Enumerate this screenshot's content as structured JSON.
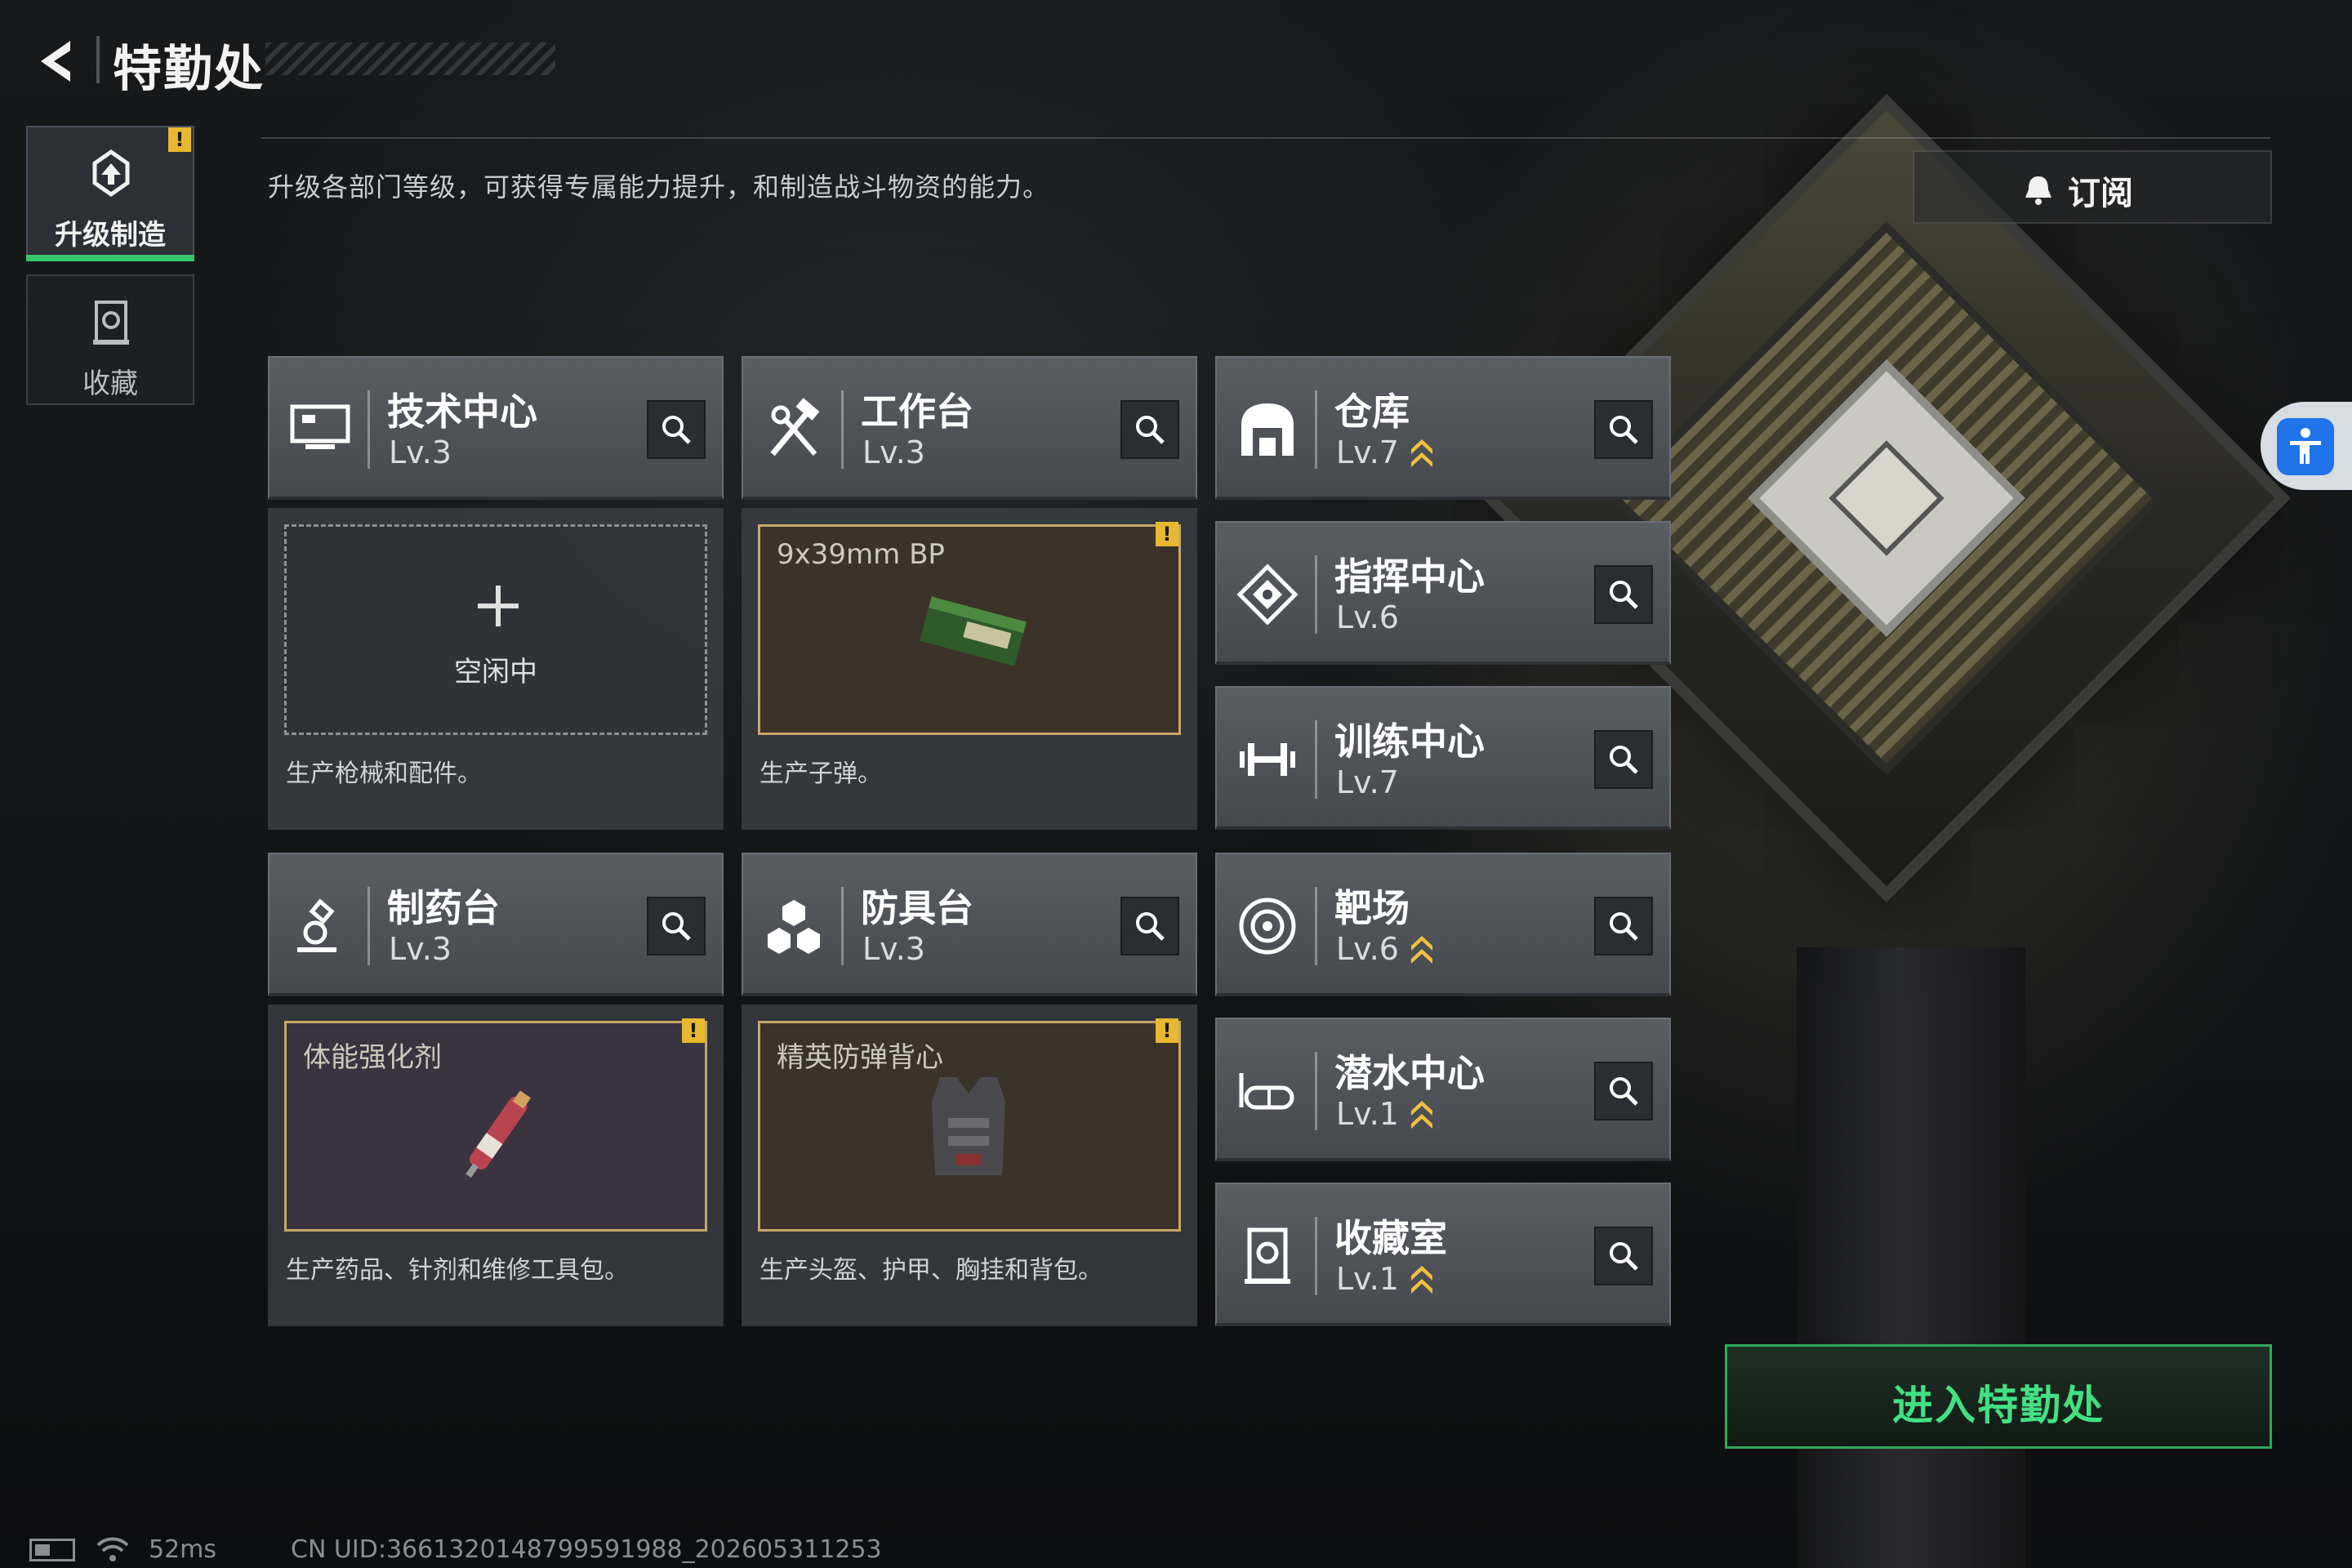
{
  "header": {
    "title": "特勤处"
  },
  "nav": [
    {
      "label": "升级制造",
      "active": true,
      "alert": "!"
    },
    {
      "label": "收藏",
      "active": false
    }
  ],
  "subtitle": "升级各部门等级，可获得专属能力提升，和制造战斗物资的能力。",
  "subscribe": {
    "label": "订阅"
  },
  "buildings": {
    "tech": {
      "name": "技术中心",
      "level": "Lv.3"
    },
    "workbench": {
      "name": "工作台",
      "level": "Lv.3"
    },
    "warehouse": {
      "name": "仓库",
      "level": "Lv.7",
      "upgradable": true
    },
    "command": {
      "name": "指挥中心",
      "level": "Lv.6"
    },
    "training": {
      "name": "训练中心",
      "level": "Lv.7"
    },
    "pharmacy": {
      "name": "制药台",
      "level": "Lv.3"
    },
    "armor": {
      "name": "防具台",
      "level": "Lv.3"
    },
    "range": {
      "name": "靶场",
      "level": "Lv.6",
      "upgradable": true
    },
    "diving": {
      "name": "潜水中心",
      "level": "Lv.1",
      "upgradable": true
    },
    "collection": {
      "name": "收藏室",
      "level": "Lv.1",
      "upgradable": true
    }
  },
  "production": {
    "tech": {
      "status": "空闲中",
      "desc": "生产枪械和配件。"
    },
    "workbench": {
      "item": "9x39mm BP",
      "desc": "生产子弹。",
      "alert": "!"
    },
    "pharmacy": {
      "item": "体能强化剂",
      "desc": "生产药品、针剂和维修工具包。",
      "alert": "!"
    },
    "armor": {
      "item": "精英防弹背心",
      "desc": "生产头盔、护甲、胸挂和背包。",
      "alert": "!"
    }
  },
  "enter_button": {
    "label": "进入特勤处"
  },
  "status": {
    "ping": "52ms",
    "uid": "CN UID:3661320148799591988_202605311253"
  },
  "colors": {
    "accent_green": "#36c46b",
    "alert_yellow": "#e8b830",
    "item_border": "#c9a66a"
  }
}
